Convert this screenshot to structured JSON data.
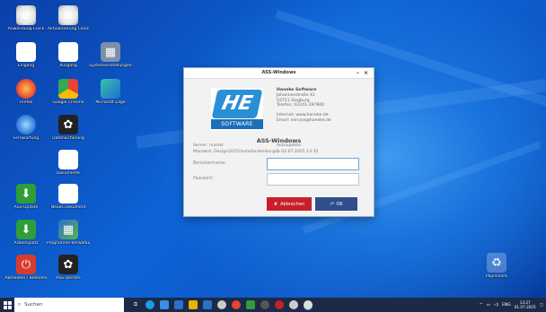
{
  "desktop": {
    "icons": [
      {
        "label": "Anwendung-Clock",
        "glyph": "⊙"
      },
      {
        "label": "Aktualisierung Clock",
        "glyph": "⊙"
      },
      {
        "label": "Eingang",
        "glyph": "⚑"
      },
      {
        "label": "Ausgang",
        "glyph": "⚑"
      },
      {
        "label": "Systemeinstellungen",
        "glyph": "▦"
      },
      {
        "label": "Firefox",
        "glyph": "●"
      },
      {
        "label": "Google Chrome",
        "glyph": ""
      },
      {
        "label": "Microsoft Edge",
        "glyph": ""
      },
      {
        "label": "Fernwartung",
        "glyph": "●"
      },
      {
        "label": "Datensicherung",
        "glyph": "✿"
      },
      {
        "label": "Dokumente",
        "glyph": "▤"
      },
      {
        "label": "ASS-Update",
        "glyph": "⬇"
      },
      {
        "label": "Neues Dokument",
        "glyph": "▤"
      },
      {
        "label": "Arbeitsplatz",
        "glyph": "⬇"
      },
      {
        "label": "Programme-Verwaltung",
        "glyph": "▦"
      },
      {
        "label": "Abmelden / Beenden",
        "glyph": "⏻"
      },
      {
        "label": "ASS-Dienste",
        "glyph": "✿"
      },
      {
        "label": "Papierkorb",
        "glyph": "♻"
      }
    ]
  },
  "dialog": {
    "title": "ASS-Windows",
    "minimize": "–",
    "close": "×",
    "logo_letters": "HE",
    "logo_software": "SOFTWARE",
    "company": {
      "name": "Haneke Software",
      "street": "Johannesstraße 41",
      "city": "53721 Siegburg",
      "phone": "Telefon: 02241-397800",
      "internet": "Internet: www.haneke.de",
      "email": "Email: service@haneke.de"
    },
    "app_title": "ASS-Windows",
    "server": "Server: master",
    "autoupdate": "Autoupdate:",
    "mandant": "Mandant: Design2025\\Installandenburgdb 02.07.2025 13:35",
    "username_label": "Benutzername:",
    "username_value": "",
    "password_label": "Passwort:",
    "password_value": "",
    "cancel_label": "Abbrechen",
    "cancel_icon": "✘",
    "ok_label": "OK",
    "ok_icon": "⏎"
  },
  "taskbar": {
    "search_placeholder": "Suchen",
    "lang": "ENG",
    "time": "13:27",
    "date": "01.07.2025"
  }
}
